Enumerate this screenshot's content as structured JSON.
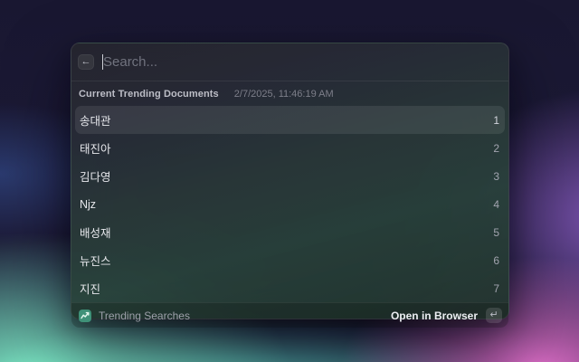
{
  "search": {
    "placeholder": "Search..."
  },
  "icons": {
    "back": "←",
    "enter": "↵"
  },
  "section": {
    "title": "Current Trending Documents",
    "timestamp": "2/7/2025, 11:46:19 AM"
  },
  "results": [
    {
      "label": "송대관",
      "rank": "1",
      "selected": true
    },
    {
      "label": "태진아",
      "rank": "2",
      "selected": false
    },
    {
      "label": "김다영",
      "rank": "3",
      "selected": false
    },
    {
      "label": "Njz",
      "rank": "4",
      "selected": false
    },
    {
      "label": "배성재",
      "rank": "5",
      "selected": false
    },
    {
      "label": "뉴진스",
      "rank": "6",
      "selected": false
    },
    {
      "label": "지진",
      "rank": "7",
      "selected": false
    }
  ],
  "footer": {
    "source_icon": "trending-chart-icon",
    "source_label": "Trending Searches",
    "action_label": "Open in Browser"
  },
  "colors": {
    "desktop_mint": "#80f1ca",
    "desktop_teal": "#62e9d0",
    "desktop_purple": "#8659bd",
    "desktop_pink": "#e571cd",
    "desktop_navy": "#191731",
    "selection": "rgba(255,255,255,0.085)",
    "source_icon_bg": "#3f9178"
  }
}
